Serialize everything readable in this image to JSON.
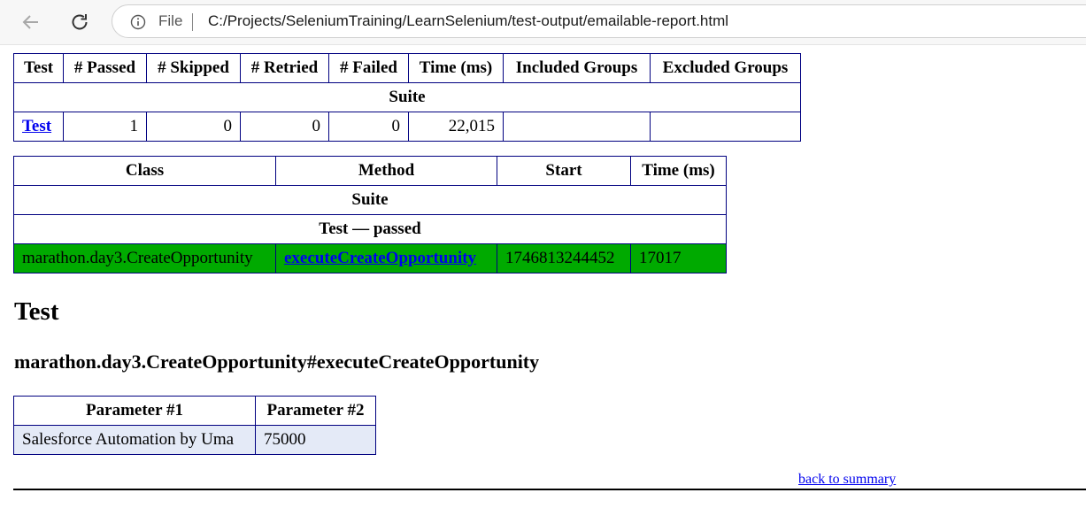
{
  "browser": {
    "file_label": "File",
    "url": "C:/Projects/SeleniumTraining/LearnSelenium/test-output/emailable-report.html"
  },
  "summary": {
    "headers": [
      "Test",
      "# Passed",
      "# Skipped",
      "# Retried",
      "# Failed",
      "Time (ms)",
      "Included Groups",
      "Excluded Groups"
    ],
    "suite_label": "Suite",
    "row": {
      "test": "Test",
      "passed": "1",
      "skipped": "0",
      "retried": "0",
      "failed": "0",
      "time_ms": "22,015",
      "included_groups": "",
      "excluded_groups": ""
    }
  },
  "methods": {
    "headers": [
      "Class",
      "Method",
      "Start",
      "Time (ms)"
    ],
    "suite_label": "Suite",
    "status_label": "Test — passed",
    "row": {
      "class": "marathon.day3.CreateOpportunity",
      "method": "executeCreateOpportunity",
      "start": "1746813244452",
      "time_ms": "17017"
    },
    "passed_color": "#00aa00"
  },
  "detail": {
    "test_title": "Test",
    "method_title": "marathon.day3.CreateOpportunity#executeCreateOpportunity",
    "param_headers": [
      "Parameter #1",
      "Parameter #2"
    ],
    "param_values": [
      "Salesforce Automation by Uma",
      "75000"
    ],
    "back_link": "back to summary"
  }
}
